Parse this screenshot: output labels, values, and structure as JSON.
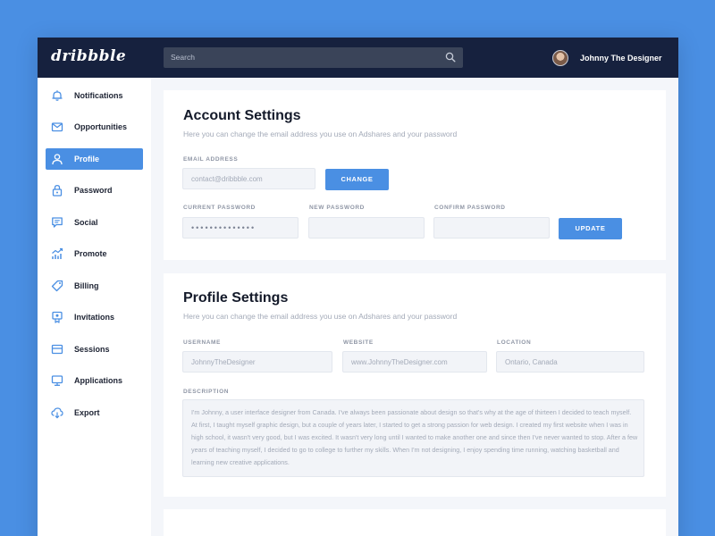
{
  "topbar": {
    "logo": "dribbble",
    "search_placeholder": "Search",
    "user_name": "Johnny The Designer"
  },
  "sidebar": {
    "items": [
      {
        "label": "Notifications",
        "icon": "bell-icon",
        "active": false
      },
      {
        "label": "Opportunities",
        "icon": "envelope-icon",
        "active": false
      },
      {
        "label": "Profile",
        "icon": "user-icon",
        "active": true
      },
      {
        "label": "Password",
        "icon": "lock-icon",
        "active": false
      },
      {
        "label": "Social",
        "icon": "chat-icon",
        "active": false
      },
      {
        "label": "Promote",
        "icon": "trend-icon",
        "active": false
      },
      {
        "label": "Billing",
        "icon": "tag-icon",
        "active": false
      },
      {
        "label": "Invitations",
        "icon": "badge-icon",
        "active": false
      },
      {
        "label": "Sessions",
        "icon": "card-icon",
        "active": false
      },
      {
        "label": "Applications",
        "icon": "monitor-icon",
        "active": false
      },
      {
        "label": "Export",
        "icon": "download-icon",
        "active": false
      }
    ]
  },
  "account": {
    "title": "Account Settings",
    "subtitle": "Here you can change the email address you use on Adshares and your password",
    "email_label": "EMAIL ADDRESS",
    "email_placeholder": "contact@dribbble.com",
    "change_button": "CHANGE",
    "current_password_label": "CURRENT PASSWORD",
    "current_password_value": "••••••••••••••",
    "new_password_label": "NEW PASSWORD",
    "confirm_password_label": "CONFIRM PASSWORD",
    "update_button": "UPDATE"
  },
  "profile": {
    "title": "Profile Settings",
    "subtitle": "Here you can change the email address you use on Adshares and your password",
    "username_label": "USERNAME",
    "username_value": "JohnnyTheDesigner",
    "website_label": "WEBSITE",
    "website_value": "www.JohnnyTheDesigner.com",
    "location_label": "LOCATION",
    "location_value": "Ontario, Canada",
    "description_label": "DESCRIPTION",
    "description_value": "I'm Johnny, a user interface designer from Canada. I've always been passionate about design so that's why at the age of thirteen I decided to teach myself. At first, I taught myself graphic design, but a couple of years later, I started to get a strong passion for web design. I created my first website when I was in high school, it wasn't very good, but I was excited. It wasn't very long until I wanted to make another one and since then I've never wanted to stop. After a few years of teaching myself, I decided to go to college to further my skills. When I'm not designing, I enjoy spending time running, watching basketball and learning new creative applications."
  },
  "colors": {
    "accent": "#4a8fe3",
    "topbar": "#16213e",
    "page_bg": "#f4f6fa"
  }
}
